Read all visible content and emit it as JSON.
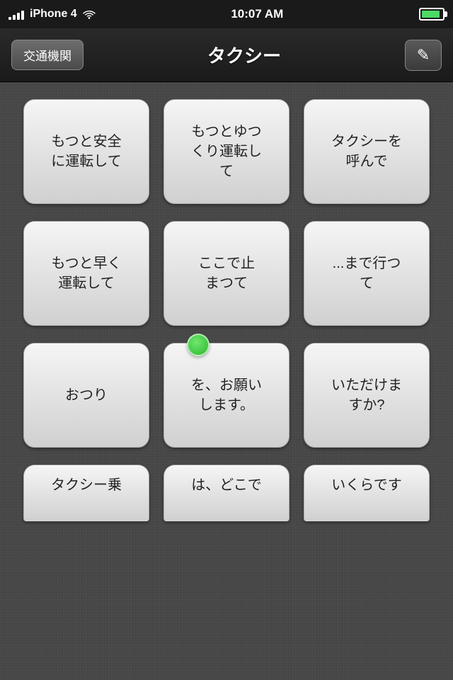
{
  "statusBar": {
    "carrier": "iPhone 4",
    "time": "10:07 AM",
    "batteryFull": true
  },
  "navBar": {
    "backLabel": "交通機関",
    "title": "タクシー",
    "editIcon": "✎"
  },
  "grid": {
    "rows": [
      {
        "cells": [
          {
            "id": "cell-1",
            "text": "もつと安全\nに運転して",
            "hasDot": false
          },
          {
            "id": "cell-2",
            "text": "もつとゆつ\nくり運転し\nて",
            "hasDot": false
          },
          {
            "id": "cell-3",
            "text": "タクシーを\n呼んで",
            "hasDot": false
          }
        ]
      },
      {
        "cells": [
          {
            "id": "cell-4",
            "text": "もつと早く\n運転して",
            "hasDot": false
          },
          {
            "id": "cell-5",
            "text": "ここで止\nまつて",
            "hasDot": false
          },
          {
            "id": "cell-6",
            "text": "...まで行つ\nて",
            "hasDot": false
          }
        ]
      },
      {
        "cells": [
          {
            "id": "cell-7",
            "text": "おつり",
            "hasDot": false
          },
          {
            "id": "cell-8",
            "text": "を、お願い\nします。",
            "hasDot": true
          },
          {
            "id": "cell-9",
            "text": "いただけま\nすか?",
            "hasDot": false
          }
        ]
      }
    ],
    "partialRow": {
      "cells": [
        {
          "id": "cell-10",
          "text": "タクシー乗"
        },
        {
          "id": "cell-11",
          "text": "は、どこで"
        },
        {
          "id": "cell-12",
          "text": "いくらです"
        }
      ]
    }
  }
}
